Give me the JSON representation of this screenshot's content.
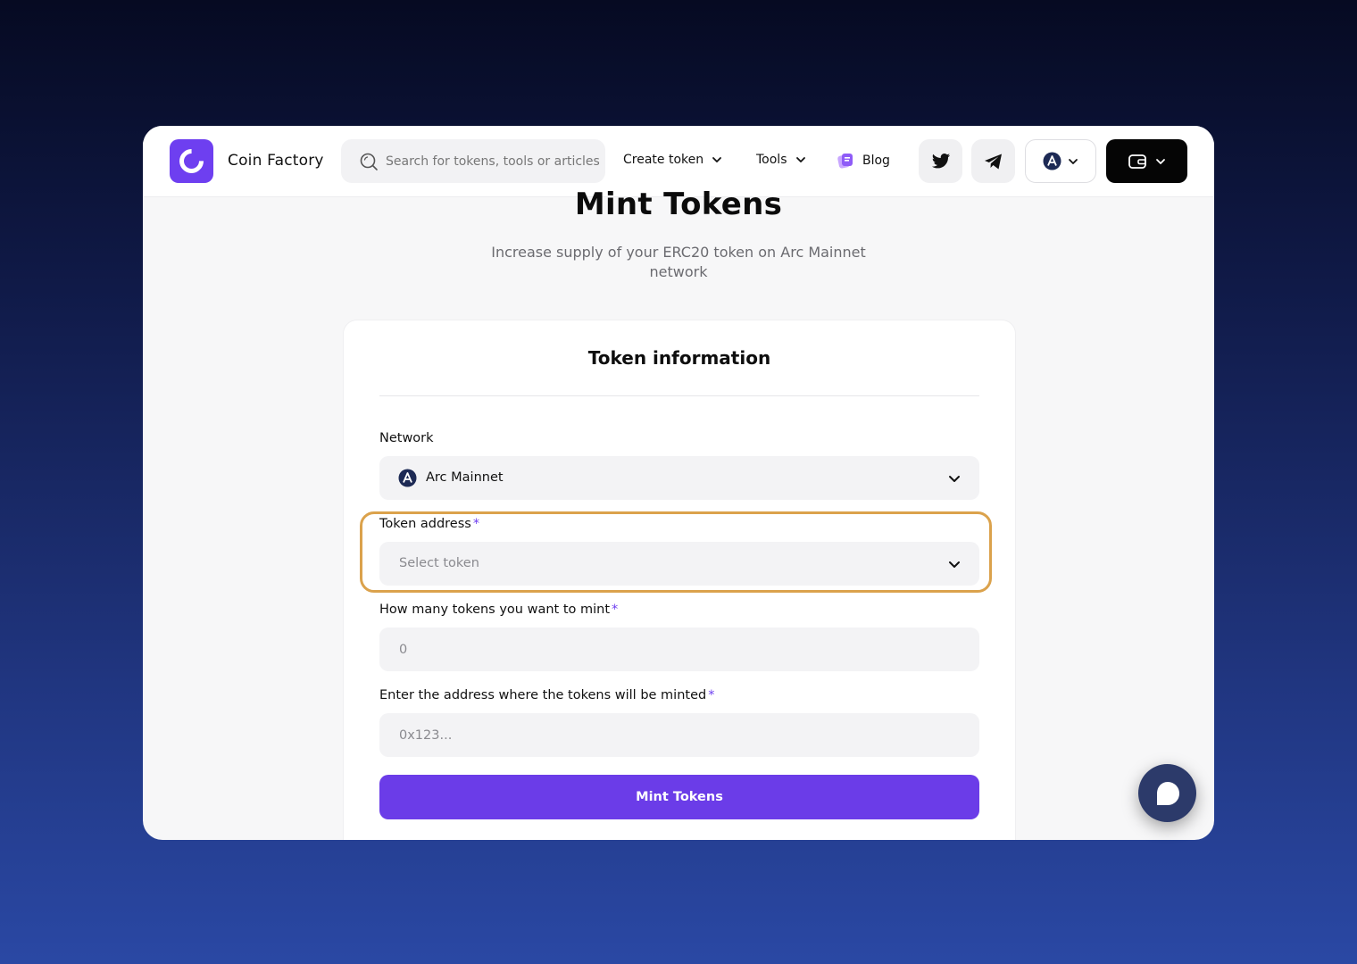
{
  "header": {
    "brand": "Coin Factory",
    "search_placeholder": "Search for tokens, tools or articles",
    "nav": {
      "create_token": "Create token",
      "tools": "Tools",
      "blog": "Blog"
    },
    "icons": [
      "twitter-icon",
      "telegram-icon",
      "arc-network-icon",
      "wallet-icon"
    ]
  },
  "page": {
    "title": "Mint Tokens",
    "subtitle": "Increase supply of your ERC20 token on Arc Mainnet network"
  },
  "form": {
    "card_title": "Token information",
    "network_label": "Network",
    "network_value": "Arc Mainnet",
    "token_address_label": "Token address",
    "token_address_placeholder": "Select token",
    "amount_label": "How many tokens you want to mint",
    "amount_placeholder": "0",
    "recipient_label": "Enter the address where the tokens will be minted",
    "recipient_placeholder": "0x123...",
    "required_mark": "*",
    "submit_label": "Mint Tokens"
  },
  "colors": {
    "accent": "#6e3ff0",
    "highlight": "#dba24c"
  }
}
